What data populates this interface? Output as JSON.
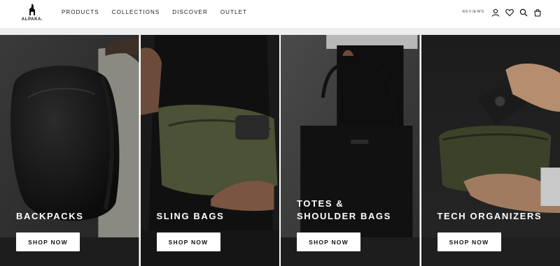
{
  "brand": {
    "name": "ALPAKA."
  },
  "nav": {
    "items": [
      {
        "label": "PRODUCTS"
      },
      {
        "label": "COLLECTIONS"
      },
      {
        "label": "DISCOVER"
      },
      {
        "label": "OUTLET"
      }
    ]
  },
  "header_right": {
    "reviews_label": "REVIEWS",
    "icons": [
      "account-icon",
      "heart-icon",
      "search-icon",
      "cart-icon"
    ]
  },
  "tiles": [
    {
      "title": "BACKPACKS",
      "button": "SHOP NOW"
    },
    {
      "title": "SLING BAGS",
      "button": "SHOP NOW"
    },
    {
      "title_line1": "TOTES &",
      "title_line2": "SHOULDER BAGS",
      "button": "SHOP NOW"
    },
    {
      "title": "TECH ORGANIZERS",
      "button": "SHOP NOW"
    }
  ],
  "colors": {
    "header_bg": "#ffffff",
    "strip_bg": "#eeeeee",
    "button_bg": "#ffffff",
    "title_text": "#ffffff"
  }
}
